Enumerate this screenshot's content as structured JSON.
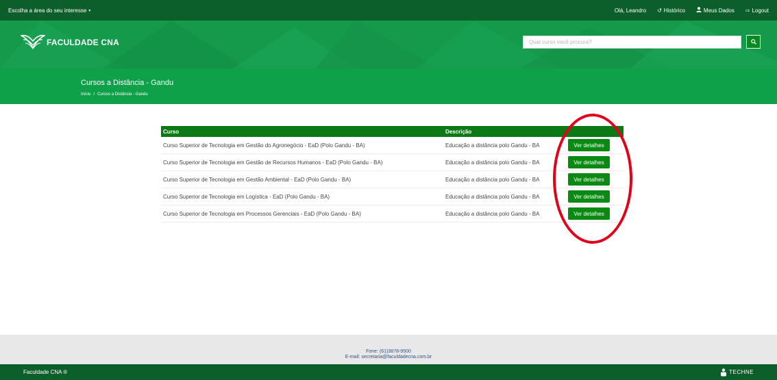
{
  "topbar": {
    "area_label": "Escolha a área do seu interesse",
    "greeting": "Olá, Leandro",
    "historico": "Histórico",
    "meus_dados": "Meus Dados",
    "logout": "Logout"
  },
  "hero": {
    "brand": "FACULDADE CNA",
    "search_placeholder": "Qual curso você procura?"
  },
  "page": {
    "title": "Cursos a Distância - Gandu",
    "breadcrumb": [
      "Início",
      "/",
      "Cursos a Distância - Gandu"
    ]
  },
  "table": {
    "headers": [
      "Curso",
      "Descrição"
    ],
    "rows": [
      {
        "curso": "Curso Superior de Tecnologia em Gestão do Agronegócio - EaD (Polo Gandu - BA)",
        "descricao": "Educação a distância polo Gandu - BA",
        "action": "Ver detalhes"
      },
      {
        "curso": "Curso Superior de Tecnologia em Gestão de Recursos Humanos - EaD (Polo Gandu - BA)",
        "descricao": "Educação a distância polo Gandu - BA",
        "action": "Ver detalhes"
      },
      {
        "curso": "Curso Superior de Tecnologia em Gestão Ambiental - EaD (Polo Gandu - BA)",
        "descricao": "Educação a distância polo Gandu - BA",
        "action": "Ver detalhes"
      },
      {
        "curso": "Curso Superior de Tecnologia em Logística - EaD (Polo Gandu - BA)",
        "descricao": "Educação a distância polo Gandu - BA",
        "action": "Ver detalhes"
      },
      {
        "curso": "Curso Superior de Tecnologia em Processos Gerenciais - EaD (Polo Gandu - BA)",
        "descricao": "Educação a distância polo Gandu - BA",
        "action": "Ver detalhes"
      }
    ]
  },
  "footer": {
    "phone": "Fone: (61)3878-9500",
    "email": "E-mail: secretaria@faculdadecna.com.br",
    "copyright": "Faculdade CNA ®",
    "partner": "TECHNE"
  },
  "colors": {
    "topbar": "#0c5f2a",
    "hero": "#159a4c",
    "band": "#0fa04a",
    "table_header": "#0b7a14",
    "button": "#0a8a12",
    "highlight": "#e2001a"
  },
  "icons": [
    "caret-down-icon",
    "history-icon",
    "user-icon",
    "logout-icon",
    "search-icon",
    "techne-logo-icon"
  ]
}
